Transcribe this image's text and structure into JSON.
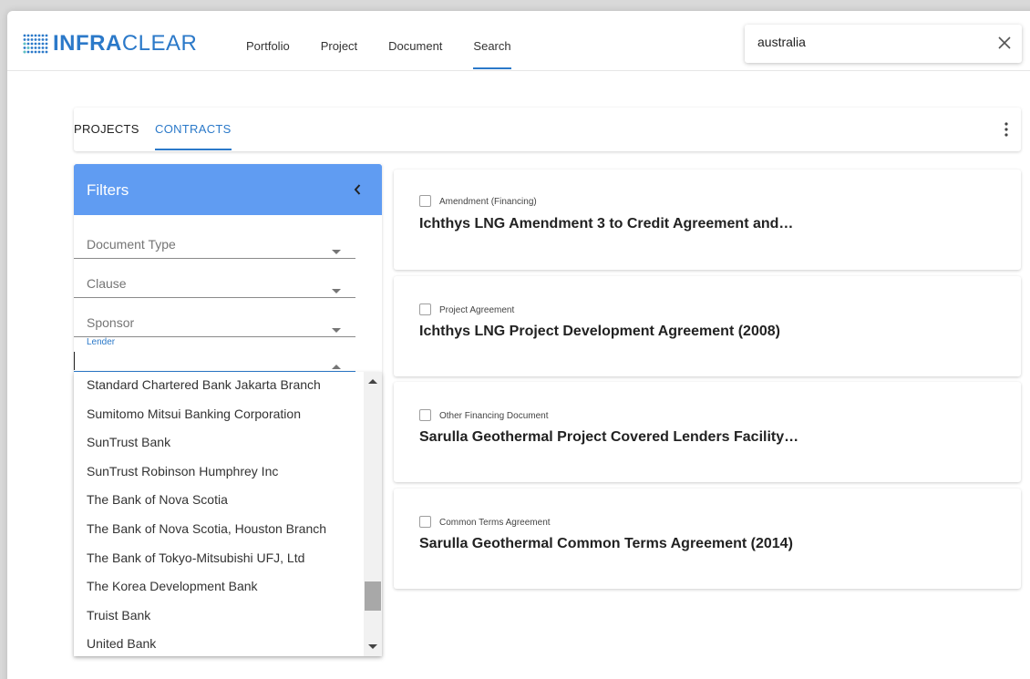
{
  "header": {
    "logo": {
      "part1": "INFRA",
      "part2": "CLEAR"
    },
    "nav": [
      {
        "label": "Portfolio"
      },
      {
        "label": "Project"
      },
      {
        "label": "Document"
      },
      {
        "label": "Search",
        "active": true
      }
    ],
    "search": {
      "value": "australia",
      "clear_icon": "close-icon"
    }
  },
  "tabs": {
    "items": [
      {
        "label": "PROJECTS"
      },
      {
        "label": "CONTRACTS",
        "active": true
      }
    ],
    "menu_icon": "more-vertical-icon"
  },
  "filters": {
    "title": "Filters",
    "collapse_icon": "chevron-left-icon",
    "fields": [
      {
        "label": "Document Type"
      },
      {
        "label": "Clause"
      },
      {
        "label": "Sponsor"
      }
    ],
    "lender": {
      "label": "Lender",
      "value": "",
      "options": [
        "Standard Chartered Bank Jakarta Branch",
        "Sumitomo Mitsui Banking Corporation",
        "SunTrust Bank",
        "SunTrust Robinson Humphrey Inc",
        "The Bank of Nova Scotia",
        "The Bank of Nova Scotia, Houston Branch",
        "The Bank of Tokyo-Mitsubishi UFJ, Ltd",
        "The Korea Development Bank",
        "Truist Bank",
        "United Bank"
      ],
      "scroll_position": 0.88
    }
  },
  "results": [
    {
      "type": "Amendment (Financing)",
      "title": "Ichthys LNG Amendment 3 to Credit Agreement and…"
    },
    {
      "type": "Project Agreement",
      "title": "Ichthys LNG Project Development Agreement (2008)"
    },
    {
      "type": "Other Financing Document",
      "title": "Sarulla Geothermal Project Covered Lenders Facility…"
    },
    {
      "type": "Common Terms Agreement",
      "title": "Sarulla Geothermal Common Terms Agreement (2014)"
    }
  ],
  "colors": {
    "accent": "#2b79c9",
    "filters_header": "#609cf2"
  }
}
